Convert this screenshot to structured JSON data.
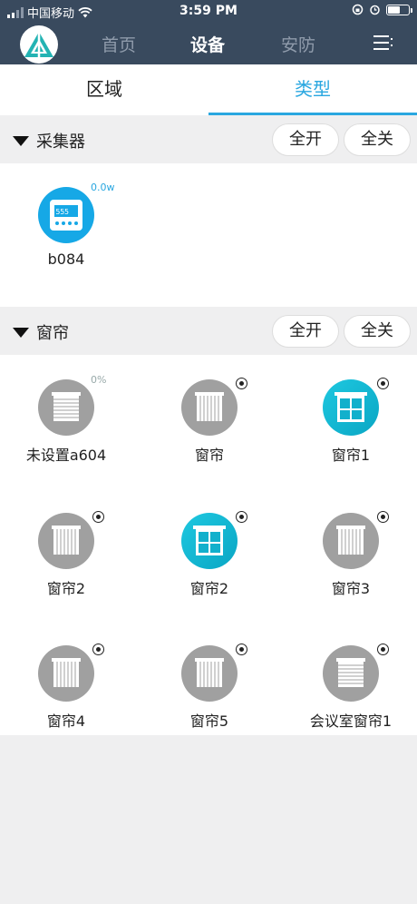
{
  "status_bar": {
    "carrier": "中国移动",
    "time": "3:59 PM"
  },
  "nav": {
    "tabs": [
      {
        "label": "首页",
        "active": false
      },
      {
        "label": "设备",
        "active": true
      },
      {
        "label": "安防",
        "active": false
      }
    ]
  },
  "subtabs": [
    {
      "label": "区域",
      "active": false
    },
    {
      "label": "类型",
      "active": true
    }
  ],
  "colors": {
    "header": "#394a5e",
    "accent": "#2aa7e0",
    "curtain_grey": "#a0a0a0",
    "curtain_cyan": "#16b8d6"
  },
  "sections": [
    {
      "title": "采集器",
      "all_on": "全开",
      "all_off": "全关",
      "devices": [
        {
          "name": "b084",
          "badge": "0.0w",
          "icon": "power-meter-icon"
        }
      ]
    },
    {
      "title": "窗帘",
      "all_on": "全开",
      "all_off": "全关",
      "devices": [
        {
          "name": "未设置a604",
          "badge": "0%",
          "icon": "roller-blind-icon"
        },
        {
          "name": "窗帘",
          "icon": "vertical-blind-icon"
        },
        {
          "name": "窗帘1",
          "icon": "window-icon"
        },
        {
          "name": "窗帘2",
          "icon": "vertical-blind-icon"
        },
        {
          "name": "窗帘2",
          "icon": "window-icon"
        },
        {
          "name": "窗帘3",
          "icon": "vertical-blind-icon"
        },
        {
          "name": "窗帘4",
          "icon": "vertical-blind-icon"
        },
        {
          "name": "窗帘5",
          "icon": "vertical-blind-icon"
        },
        {
          "name": "会议室窗帘1",
          "icon": "roller-blind-icon"
        }
      ]
    }
  ]
}
